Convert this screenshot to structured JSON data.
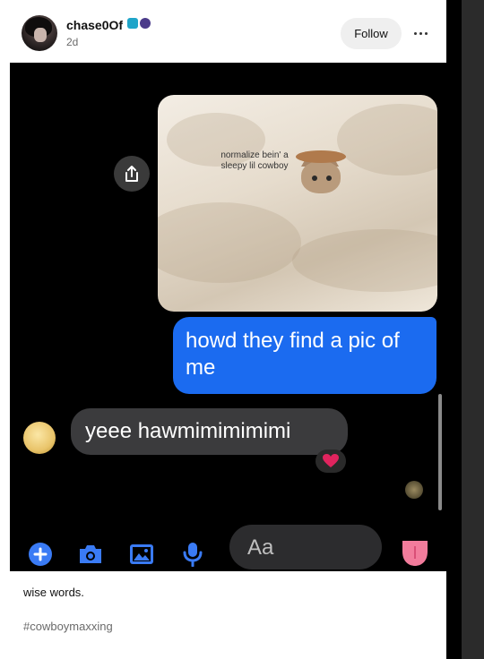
{
  "post": {
    "username": "chase0Of",
    "timestamp": "2d",
    "follow_label": "Follow",
    "body_text": "wise words.",
    "tags": [
      "#cowboymaxxing"
    ]
  },
  "screenshot": {
    "photo_caption": "normalize bein' a sleepy lil cowboy",
    "sent_message": "howd they find a pic of me",
    "received_message": "yeee hawmimimimimi",
    "reaction": "heart",
    "composer_placeholder": "Aa",
    "composer_icons": [
      "plus-icon",
      "camera-icon",
      "image-icon",
      "mic-icon",
      "emoji-icon"
    ]
  },
  "colors": {
    "sent_bubble": "#1b6bf0",
    "received_bubble": "#3b3b3d",
    "composer_icon": "#3a7bf5",
    "reaction_heart": "#e0245e"
  }
}
